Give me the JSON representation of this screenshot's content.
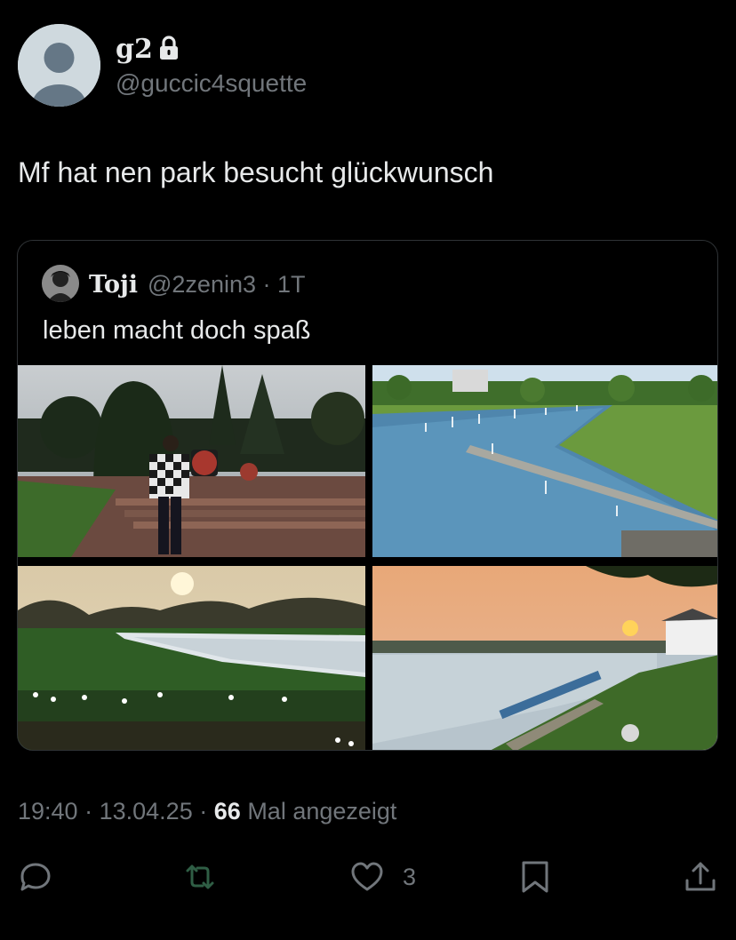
{
  "tweet": {
    "display_name": "g2",
    "handle": "@guccic4squette",
    "text": "Mf hat nen park besucht glückwunsch",
    "time": "19:40",
    "date": "13.04.25",
    "views_count": "66",
    "views_label": "Mal angezeigt",
    "separator": "·"
  },
  "quote": {
    "display_name": "Toji",
    "handle_time": "@2zenin3 · 1T",
    "text": "leben macht doch spaß"
  },
  "actions": {
    "like_count": "3"
  },
  "icons": {
    "lock": "lock-icon",
    "reply": "reply-icon",
    "retweet": "retweet-icon",
    "like": "heart-icon",
    "bookmark": "bookmark-icon",
    "share": "share-icon"
  },
  "colors": {
    "background": "#000000",
    "text_primary": "#e7e9ea",
    "text_secondary": "#71767b",
    "border": "#2f3336"
  }
}
